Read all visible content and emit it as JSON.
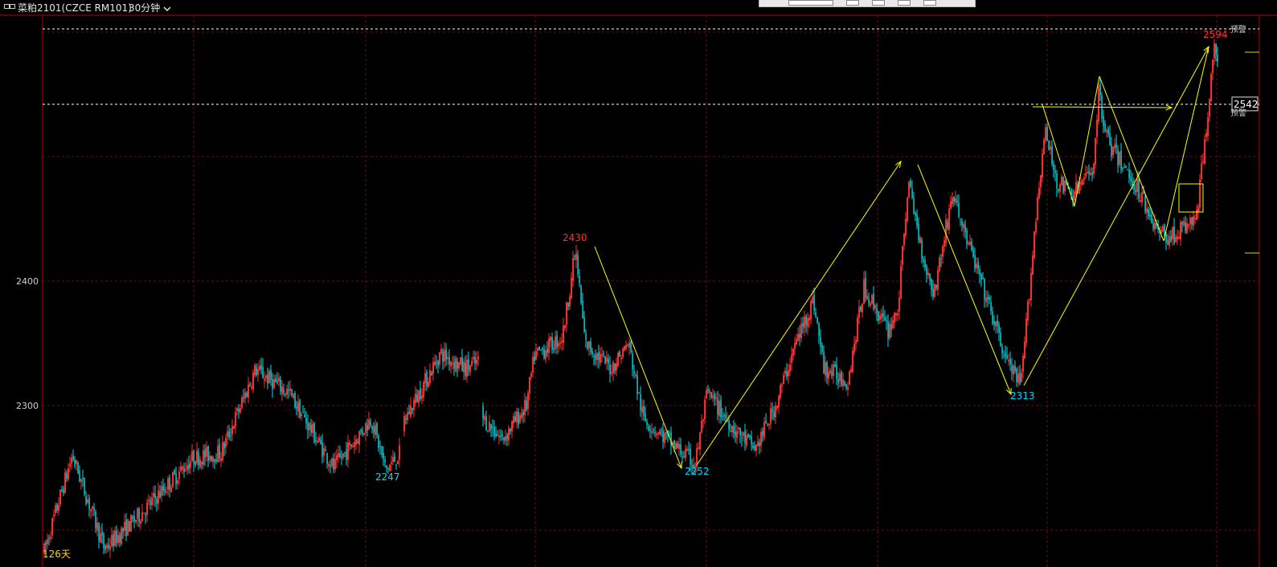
{
  "header": {
    "title": "菜粕2101(CZCE RM101)",
    "period": "30分钟",
    "period_arrow": "chevron-down-icon",
    "link_icon": "link-icon"
  },
  "chart_data": {
    "type": "candlestick",
    "y_ticks": [
      {
        "value": 2300,
        "label": "2300"
      },
      {
        "value": 2400,
        "label": "2400"
      }
    ],
    "price_markers": [
      {
        "value": 2542,
        "label": "2542"
      }
    ],
    "right_notes": [
      {
        "value": 2594,
        "label": "预警"
      },
      {
        "value": 2542,
        "label": "预警"
      }
    ],
    "annotations": [
      {
        "label": "2430",
        "value": 2430,
        "color": "#ff3030"
      },
      {
        "label": "2247",
        "value": 2247,
        "color": "#00d8ff"
      },
      {
        "label": "2252",
        "value": 2252,
        "color": "#00d8ff"
      },
      {
        "label": "2313",
        "value": 2313,
        "color": "#00d8ff"
      },
      {
        "label": "2594",
        "value": 2594,
        "color": "#ff3030"
      }
    ],
    "footer_label": "126天",
    "colors": {
      "up": "#ff3232",
      "down": "#00e5ee",
      "trendline": "#ffff00",
      "grid": "#8b0000",
      "frame": "#c00000",
      "alert_line": "#ffffff"
    }
  }
}
